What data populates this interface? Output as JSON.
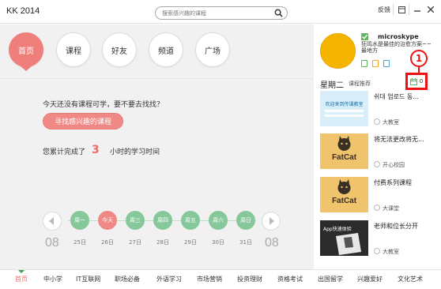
{
  "app": {
    "title": "KK 2014"
  },
  "search": {
    "placeholder": "搜索感兴趣的课程"
  },
  "window": {
    "feedback": "反馈"
  },
  "nav": {
    "items": [
      {
        "label": "首页",
        "active": true
      },
      {
        "label": "课程"
      },
      {
        "label": "好友"
      },
      {
        "label": "频道"
      },
      {
        "label": "广场"
      }
    ]
  },
  "main": {
    "tip": "今天还没有课程可学，要不要去找找？",
    "find_button": "寻找感兴趣的课程",
    "done_prefix": "您累计完成了",
    "done_hours": "3",
    "done_suffix": "小时的学习时间"
  },
  "week": {
    "month_left": "08",
    "month_right": "08",
    "days": [
      {
        "label": "周一",
        "date": "25日"
      },
      {
        "label": "今天",
        "date": "26日",
        "today": true
      },
      {
        "label": "周三",
        "date": "27日"
      },
      {
        "label": "周四",
        "date": "28日"
      },
      {
        "label": "周五",
        "date": "29日"
      },
      {
        "label": "周六",
        "date": "30日"
      },
      {
        "label": "周日",
        "date": "31日"
      }
    ]
  },
  "profile": {
    "username": "microskype",
    "motto": "狂鸣水是最佳的治愈方案~~最地方"
  },
  "recommend": {
    "weekday": "星期二",
    "label": "课程推荐",
    "count": "0",
    "callout_number": "1",
    "items": [
      {
        "title": "쉬대 업로드 동...",
        "source": "大教室",
        "thumb": "blue",
        "thumb_text": "欢迎来到传课教室"
      },
      {
        "title": "将无法更改将无...",
        "source": "开心校园",
        "thumb": "fatcat",
        "thumb_text": "FatCat"
      },
      {
        "title": "付费系列课程",
        "source": "大课堂",
        "thumb": "fatcat",
        "thumb_text": "FatCat"
      },
      {
        "title": "老师和位长分开",
        "source": "大教室",
        "thumb": "dark",
        "thumb_text": "App快速体验"
      }
    ]
  },
  "categories": [
    {
      "label": "首页",
      "active": true
    },
    {
      "label": "中小学"
    },
    {
      "label": "IT互联网"
    },
    {
      "label": "职场必备"
    },
    {
      "label": "外语学习"
    },
    {
      "label": "市场营销"
    },
    {
      "label": "投资理财"
    },
    {
      "label": "资格考试"
    },
    {
      "label": "出国留学"
    },
    {
      "label": "兴趣爱好"
    },
    {
      "label": "文化艺术"
    }
  ],
  "colors": {
    "accent": "#ef7f7b",
    "green": "#86c89a",
    "callout": "#ee1111"
  }
}
